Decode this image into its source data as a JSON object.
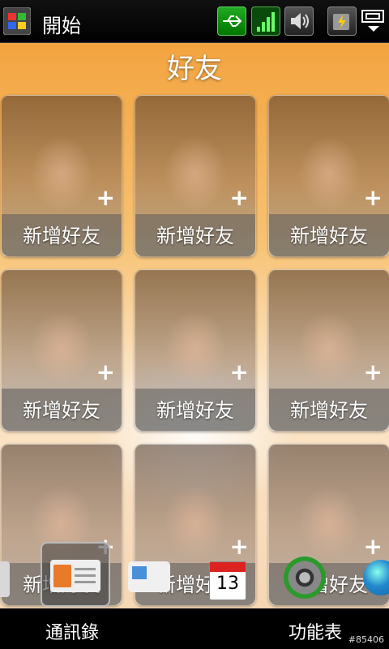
{
  "status_bar": {
    "start_label": "開始",
    "icons": [
      "windows-start-icon",
      "usb-icon",
      "signal-icon",
      "sound-icon",
      "battery-icon",
      "connection-icon"
    ]
  },
  "page": {
    "title": "好友"
  },
  "tiles": [
    {
      "label": "新增好友",
      "plus": "+"
    },
    {
      "label": "新增好友",
      "plus": "+"
    },
    {
      "label": "新增好友",
      "plus": "+"
    },
    {
      "label": "新增好友",
      "plus": "+"
    },
    {
      "label": "新增好友",
      "plus": "+"
    },
    {
      "label": "新增好友",
      "plus": "+"
    },
    {
      "label": "新增好友",
      "plus": "+"
    },
    {
      "label": "新增好友",
      "plus": "+"
    },
    {
      "label": "新增好友",
      "plus": "+"
    }
  ],
  "dock": {
    "items": [
      "home-icon",
      "contacts-icon",
      "messages-icon",
      "calendar-icon",
      "settings-icon",
      "browser-icon"
    ],
    "calendar_day": "13"
  },
  "softkeys": {
    "left": "通訊錄",
    "right": "功能表"
  },
  "watermark": "#85406",
  "colors": {
    "accent_orange": "#f3a440",
    "calendar_red": "#d22222"
  }
}
